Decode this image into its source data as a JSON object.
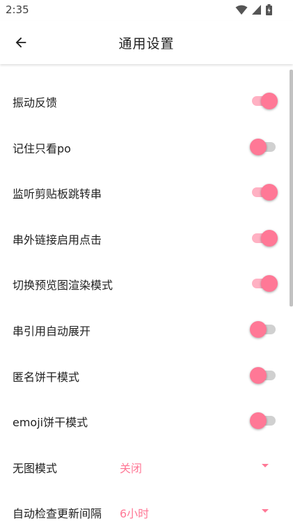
{
  "status_bar": {
    "time": "2:35"
  },
  "header": {
    "title": "通用设置",
    "back_icon": "arrow-back-icon"
  },
  "colors": {
    "accent": "#ff7896",
    "accent_light": "#ffb1c3",
    "track_off": "#d0d0d0"
  },
  "settings": {
    "toggles": [
      {
        "label": "振动反馈",
        "checked": true
      },
      {
        "label": "记住只看po",
        "checked": false
      },
      {
        "label": "监听剪贴板跳转串",
        "checked": true
      },
      {
        "label": "串外链接启用点击",
        "checked": true
      },
      {
        "label": "切换预览图渲染模式",
        "checked": true
      },
      {
        "label": "串引用自动展开",
        "checked": false
      },
      {
        "label": "匿名饼干模式",
        "checked": false
      },
      {
        "label": "emoji饼干模式",
        "checked": false
      }
    ],
    "selects": [
      {
        "label": "无图模式",
        "value": "关闭"
      },
      {
        "label": "自动检查更新间隔",
        "value": "6小时"
      }
    ]
  }
}
